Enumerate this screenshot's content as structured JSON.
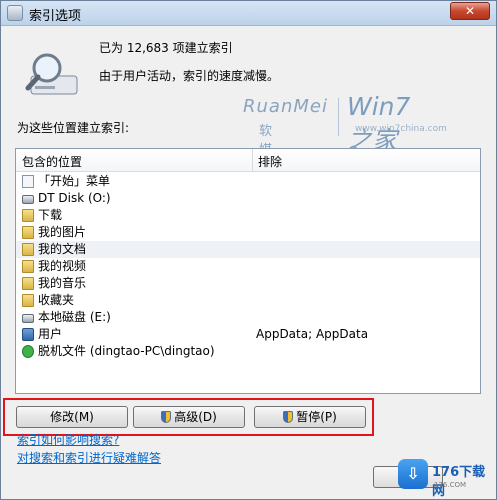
{
  "window": {
    "title": "索引选项",
    "close_glyph": "✕"
  },
  "status": {
    "line1": "已为 12,683 项建立索引",
    "line2": "由于用户活动，索引的速度减慢。"
  },
  "watermark": {
    "ruanmei": "RuanMei",
    "ruanmei_cn": "软媒",
    "win7": "Win7之家",
    "url": "www.win7china.com"
  },
  "section_label": "为这些位置建立索引:",
  "list": {
    "col_location": "包含的位置",
    "col_exclude": "排除",
    "rows": [
      {
        "name": "「开始」菜单",
        "exclude": "",
        "icon": "doc-icon"
      },
      {
        "name": "DT Disk (O:)",
        "exclude": "",
        "icon": "disk-icon"
      },
      {
        "name": "下载",
        "exclude": "",
        "icon": "folder-icon"
      },
      {
        "name": "我的图片",
        "exclude": "",
        "icon": "folder-icon"
      },
      {
        "name": "我的文档",
        "exclude": "",
        "icon": "folder-icon"
      },
      {
        "name": "我的视频",
        "exclude": "",
        "icon": "folder-icon"
      },
      {
        "name": "我的音乐",
        "exclude": "",
        "icon": "folder-icon"
      },
      {
        "name": "收藏夹",
        "exclude": "",
        "icon": "folder-icon"
      },
      {
        "name": "本地磁盘 (E:)",
        "exclude": "",
        "icon": "disk-icon"
      },
      {
        "name": "用户",
        "exclude": "AppData; AppData",
        "icon": "folder-icon"
      },
      {
        "name": "脱机文件 (dingtao-PC\\dingtao)",
        "exclude": "",
        "icon": "sync-icon"
      }
    ]
  },
  "buttons": {
    "modify": "修改(M)",
    "advanced": "高级(D)",
    "pause": "暂停(P)"
  },
  "links": {
    "how_indexing": "索引如何影响搜索?",
    "troubleshoot": "对搜索和索引进行疑难解答"
  },
  "badge": {
    "icon_glyph": "⇩",
    "text": "176下载网",
    "sub": "176.COM"
  }
}
